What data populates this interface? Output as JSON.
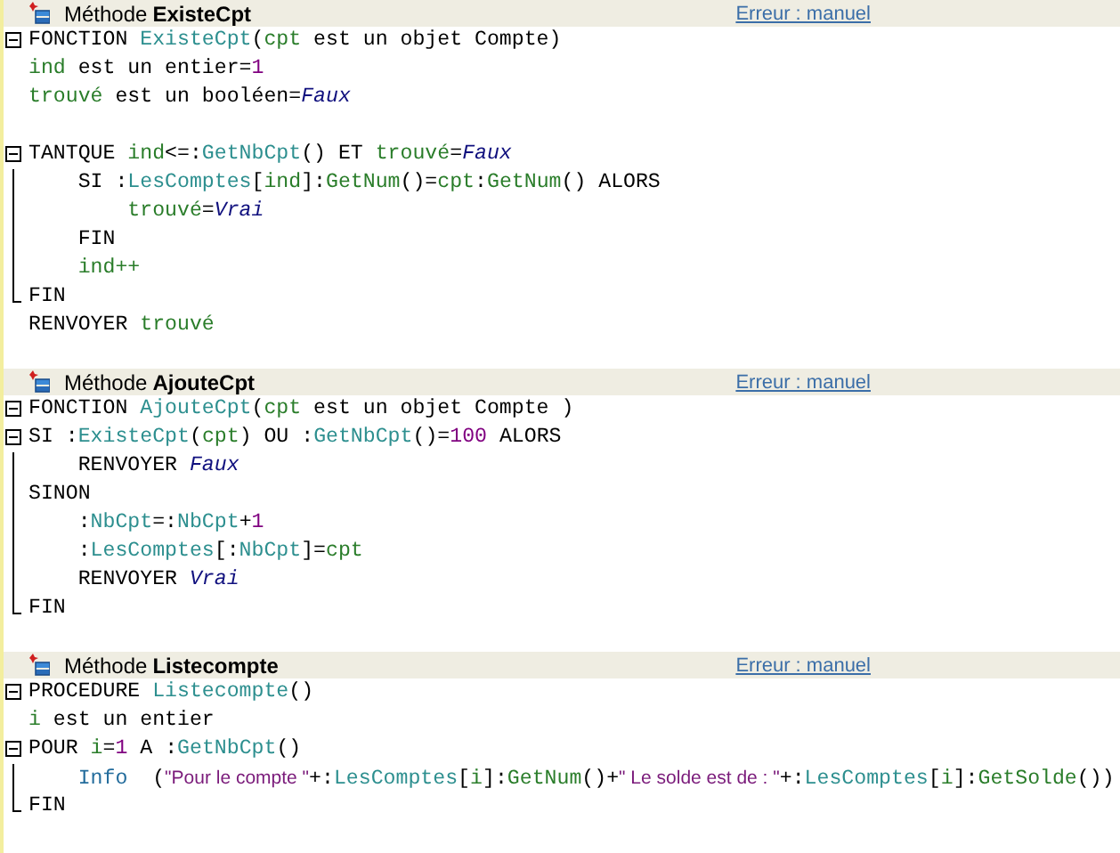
{
  "methods": [
    {
      "label": "Méthode",
      "name": "ExisteCpt",
      "link": "Erreur : manuel",
      "lines": [
        {
          "kind": "box",
          "tokens": [
            {
              "kind": "kw",
              "text": "FONCTION "
            },
            {
              "kind": "proc",
              "text": "ExisteCpt"
            },
            {
              "kind": "kw",
              "text": "("
            },
            {
              "kind": "var",
              "text": "cpt"
            },
            {
              "kind": "kw",
              "text": " est un objet Compte)"
            }
          ]
        },
        {
          "kind": "plain",
          "tokens": [
            {
              "kind": "var",
              "text": "ind"
            },
            {
              "kind": "kw",
              "text": " est un entier="
            },
            {
              "kind": "num",
              "text": "1"
            }
          ]
        },
        {
          "kind": "plain",
          "tokens": [
            {
              "kind": "var",
              "text": "trouvé"
            },
            {
              "kind": "kw",
              "text": " est un booléen="
            },
            {
              "kind": "const",
              "text": "Faux"
            }
          ]
        },
        {
          "kind": "blank"
        },
        {
          "kind": "box-tail",
          "tokens": [
            {
              "kind": "kw",
              "text": "TANTQUE "
            },
            {
              "kind": "var",
              "text": "ind"
            },
            {
              "kind": "kw",
              "text": "<=:"
            },
            {
              "kind": "proc",
              "text": "GetNbCpt"
            },
            {
              "kind": "kw",
              "text": "() ET "
            },
            {
              "kind": "var",
              "text": "trouvé"
            },
            {
              "kind": "kw",
              "text": "="
            },
            {
              "kind": "const",
              "text": "Faux"
            }
          ]
        },
        {
          "kind": "guide",
          "tokens": [
            {
              "kind": "kw",
              "text": "    SI :"
            },
            {
              "kind": "proc",
              "text": "LesComptes"
            },
            {
              "kind": "kw",
              "text": "["
            },
            {
              "kind": "var",
              "text": "ind"
            },
            {
              "kind": "kw",
              "text": "]:"
            },
            {
              "kind": "var",
              "text": "GetNum"
            },
            {
              "kind": "kw",
              "text": "()="
            },
            {
              "kind": "var",
              "text": "cpt"
            },
            {
              "kind": "kw",
              "text": ":"
            },
            {
              "kind": "var",
              "text": "GetNum"
            },
            {
              "kind": "kw",
              "text": "() ALORS"
            }
          ]
        },
        {
          "kind": "guide",
          "tokens": [
            {
              "kind": "var",
              "text": "        trouvé"
            },
            {
              "kind": "kw",
              "text": "="
            },
            {
              "kind": "const",
              "text": "Vrai"
            }
          ]
        },
        {
          "kind": "guide",
          "tokens": [
            {
              "kind": "kw",
              "text": "    FIN"
            }
          ]
        },
        {
          "kind": "guide",
          "tokens": [
            {
              "kind": "var",
              "text": "    ind++"
            }
          ]
        },
        {
          "kind": "end",
          "tokens": [
            {
              "kind": "kw",
              "text": "FIN"
            }
          ]
        },
        {
          "kind": "plain",
          "tokens": [
            {
              "kind": "kw",
              "text": "RENVOYER "
            },
            {
              "kind": "var",
              "text": "trouvé"
            }
          ]
        }
      ]
    },
    {
      "label": "Méthode",
      "name": "AjouteCpt",
      "link": "Erreur : manuel",
      "lines": [
        {
          "kind": "box",
          "tokens": [
            {
              "kind": "kw",
              "text": "FONCTION "
            },
            {
              "kind": "proc",
              "text": "AjouteCpt"
            },
            {
              "kind": "kw",
              "text": "("
            },
            {
              "kind": "var",
              "text": "cpt"
            },
            {
              "kind": "kw",
              "text": " est un objet Compte )"
            }
          ]
        },
        {
          "kind": "box-tail",
          "tokens": [
            {
              "kind": "kw",
              "text": "SI :"
            },
            {
              "kind": "proc",
              "text": "ExisteCpt"
            },
            {
              "kind": "kw",
              "text": "("
            },
            {
              "kind": "var",
              "text": "cpt"
            },
            {
              "kind": "kw",
              "text": ") OU :"
            },
            {
              "kind": "proc",
              "text": "GetNbCpt"
            },
            {
              "kind": "kw",
              "text": "()="
            },
            {
              "kind": "num",
              "text": "100"
            },
            {
              "kind": "kw",
              "text": " ALORS"
            }
          ]
        },
        {
          "kind": "guide",
          "tokens": [
            {
              "kind": "kw",
              "text": "    RENVOYER "
            },
            {
              "kind": "const",
              "text": "Faux"
            }
          ]
        },
        {
          "kind": "guide",
          "tokens": [
            {
              "kind": "kw",
              "text": "SINON"
            }
          ]
        },
        {
          "kind": "guide",
          "tokens": [
            {
              "kind": "kw",
              "text": "    :"
            },
            {
              "kind": "proc",
              "text": "NbCpt"
            },
            {
              "kind": "kw",
              "text": "=:"
            },
            {
              "kind": "proc",
              "text": "NbCpt"
            },
            {
              "kind": "kw",
              "text": "+"
            },
            {
              "kind": "num",
              "text": "1"
            }
          ]
        },
        {
          "kind": "guide",
          "tokens": [
            {
              "kind": "kw",
              "text": "    :"
            },
            {
              "kind": "proc",
              "text": "LesComptes"
            },
            {
              "kind": "kw",
              "text": "[:"
            },
            {
              "kind": "proc",
              "text": "NbCpt"
            },
            {
              "kind": "kw",
              "text": "]="
            },
            {
              "kind": "var",
              "text": "cpt"
            }
          ]
        },
        {
          "kind": "guide",
          "tokens": [
            {
              "kind": "kw",
              "text": "    RENVOYER "
            },
            {
              "kind": "const",
              "text": "Vrai"
            }
          ]
        },
        {
          "kind": "end",
          "tokens": [
            {
              "kind": "kw",
              "text": "FIN"
            }
          ]
        }
      ]
    },
    {
      "label": "Méthode",
      "name": "Listecompte",
      "link": "Erreur : manuel",
      "lines": [
        {
          "kind": "box",
          "tokens": [
            {
              "kind": "kw",
              "text": "PROCEDURE "
            },
            {
              "kind": "proc",
              "text": "Listecompte"
            },
            {
              "kind": "kw",
              "text": "()"
            }
          ]
        },
        {
          "kind": "plain",
          "tokens": [
            {
              "kind": "var",
              "text": "i"
            },
            {
              "kind": "kw",
              "text": " est un entier"
            }
          ]
        },
        {
          "kind": "box-tail",
          "tokens": [
            {
              "kind": "kw",
              "text": "POUR "
            },
            {
              "kind": "var",
              "text": "i"
            },
            {
              "kind": "kw",
              "text": "="
            },
            {
              "kind": "num",
              "text": "1"
            },
            {
              "kind": "kw",
              "text": " A :"
            },
            {
              "kind": "proc",
              "text": "GetNbCpt"
            },
            {
              "kind": "kw",
              "text": "()"
            }
          ]
        },
        {
          "kind": "guide",
          "tokens": [
            {
              "kind": "func",
              "text": "    Info"
            },
            {
              "kind": "kw",
              "text": "  ("
            },
            {
              "kind": "str",
              "text": "\"Pour le compte \""
            },
            {
              "kind": "kw",
              "text": "+:"
            },
            {
              "kind": "proc",
              "text": "LesComptes"
            },
            {
              "kind": "kw",
              "text": "["
            },
            {
              "kind": "var",
              "text": "i"
            },
            {
              "kind": "kw",
              "text": "]:"
            },
            {
              "kind": "var",
              "text": "GetNum"
            },
            {
              "kind": "kw",
              "text": "()+"
            },
            {
              "kind": "str",
              "text": "\" Le solde est de : \""
            },
            {
              "kind": "kw",
              "text": "+:"
            },
            {
              "kind": "proc",
              "text": "LesComptes"
            },
            {
              "kind": "kw",
              "text": "["
            },
            {
              "kind": "var",
              "text": "i"
            },
            {
              "kind": "kw",
              "text": "]:"
            },
            {
              "kind": "var",
              "text": "GetSolde"
            },
            {
              "kind": "kw",
              "text": "())"
            }
          ]
        },
        {
          "kind": "end",
          "tokens": [
            {
              "kind": "kw",
              "text": "FIN"
            }
          ]
        }
      ]
    }
  ]
}
